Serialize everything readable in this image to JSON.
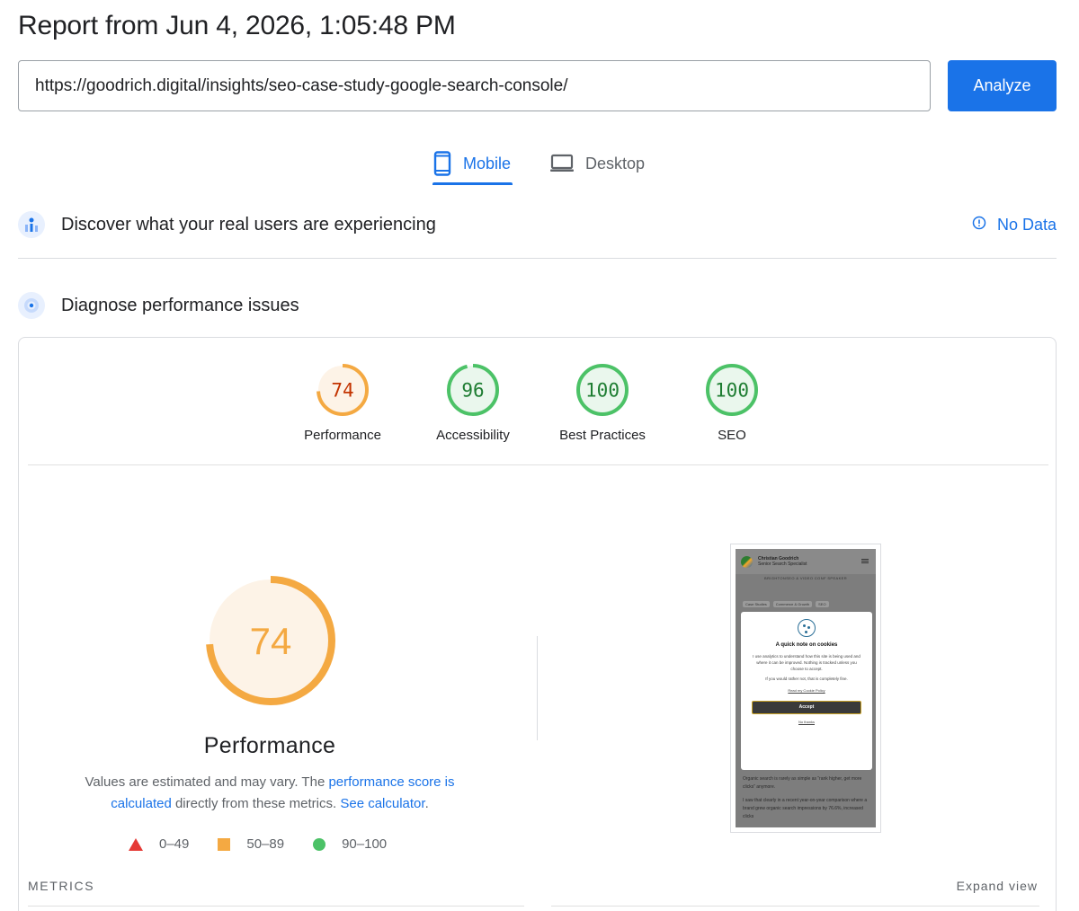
{
  "report": {
    "title": "Report from Jun 4, 2026, 1:05:48 PM"
  },
  "search": {
    "url_value": "https://goodrich.digital/insights/seo-case-study-google-search-console/",
    "analyze_label": "Analyze"
  },
  "tabs": [
    {
      "label": "Mobile",
      "active": true,
      "icon": "smartphone-icon"
    },
    {
      "label": "Desktop",
      "active": false,
      "icon": "laptop-icon"
    }
  ],
  "field_data": {
    "title": "Discover what your real users are experiencing",
    "status_label": "No Data",
    "status_icon": "info-icon"
  },
  "lab_data": {
    "title": "Diagnose performance issues"
  },
  "scores": [
    {
      "label": "Performance",
      "value": 74,
      "color": "#f4a942",
      "fill": "#fdf3e7",
      "text_color": "#c33300"
    },
    {
      "label": "Accessibility",
      "value": 96,
      "color": "#4cc267",
      "fill": "#eaf7ed",
      "text_color": "#1e7d32"
    },
    {
      "label": "Best Practices",
      "value": 100,
      "color": "#4cc267",
      "fill": "#eaf7ed",
      "text_color": "#1e7d32"
    },
    {
      "label": "SEO",
      "value": 100,
      "color": "#4cc267",
      "fill": "#eaf7ed",
      "text_color": "#1e7d32"
    }
  ],
  "performance": {
    "score": 74,
    "title": "Performance",
    "desc_prefix": "Values are estimated and may vary. The ",
    "link_score": "performance score is calculated",
    "desc_mid": " directly from these metrics. ",
    "link_calc": "See calculator",
    "desc_suffix": ".",
    "gauge_color": "#f4a942",
    "gauge_fill": "#fdf3e7",
    "number_color": "#f4a942"
  },
  "legend": [
    {
      "range": "0–49",
      "shape": "triangle",
      "color": "#e53935"
    },
    {
      "range": "50–89",
      "shape": "square",
      "color": "#f4a942"
    },
    {
      "range": "90–100",
      "shape": "circle",
      "color": "#4cc267"
    }
  ],
  "screenshot": {
    "site_name": "Christian Goodrich",
    "site_role": "Senior Search Specialist",
    "banner": "BRIGHTONSEO & VIDEO CONF SPEAKER",
    "tags": [
      "Case Studies",
      "Commerce & Growth",
      "SEO"
    ],
    "modal_title": "A quick note on cookies",
    "modal_text_1": "I use analytics to understand how this site is being used and where it can be improved. Nothing is tracked unless you choose to accept.",
    "modal_text_2": "If you would rather not, that is completely fine.",
    "modal_link": "Read my Cookie Policy",
    "accept_label": "Accept",
    "decline_label": "No thanks",
    "body_1": "Organic search is rarely as simple as “rank higher, get more clicks” anymore.",
    "body_2": "I saw that clearly in a recent year-on-year comparison where a brand grew organic search impressions by 76.6%, increased clicks"
  },
  "metrics": {
    "label": "METRICS",
    "expand_label": "Expand view"
  }
}
